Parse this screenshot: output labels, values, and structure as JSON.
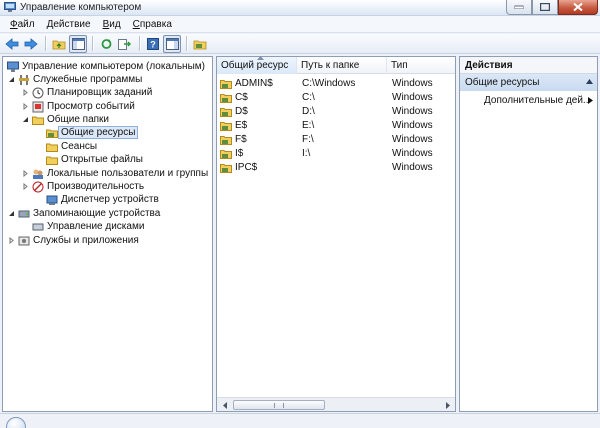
{
  "window": {
    "title": "Управление компьютером"
  },
  "menu": [
    {
      "u": "Ф",
      "rest": "айл"
    },
    {
      "u": "Д",
      "rest": "ействие"
    },
    {
      "u": "В",
      "rest": "ид"
    },
    {
      "u": "С",
      "rest": "правка"
    }
  ],
  "tree": {
    "root": "Управление компьютером (локальным)",
    "system_tools": "Служебные программы",
    "task_scheduler": "Планировщик заданий",
    "event_viewer": "Просмотр событий",
    "shared_folders": "Общие папки",
    "shares": "Общие ресурсы",
    "sessions": "Сеансы",
    "open_files": "Открытые файлы",
    "local_users": "Локальные пользователи и группы",
    "performance": "Производительность",
    "device_manager": "Диспетчер устройств",
    "storage": "Запоминающие устройства",
    "disk_management": "Управление дисками",
    "services_apps": "Службы и приложения"
  },
  "list": {
    "columns": [
      "Общий ресурс",
      "Путь к папке",
      "Тип"
    ],
    "rows": [
      {
        "name": "ADMIN$",
        "path": "C:\\Windows",
        "type": "Windows"
      },
      {
        "name": "C$",
        "path": "C:\\",
        "type": "Windows"
      },
      {
        "name": "D$",
        "path": "D:\\",
        "type": "Windows"
      },
      {
        "name": "E$",
        "path": "E:\\",
        "type": "Windows"
      },
      {
        "name": "F$",
        "path": "F:\\",
        "type": "Windows"
      },
      {
        "name": "I$",
        "path": "I:\\",
        "type": "Windows"
      },
      {
        "name": "IPC$",
        "path": "",
        "type": "Windows"
      }
    ]
  },
  "actions": {
    "header": "Действия",
    "section": "Общие ресурсы",
    "more": "Дополнительные дей..."
  }
}
